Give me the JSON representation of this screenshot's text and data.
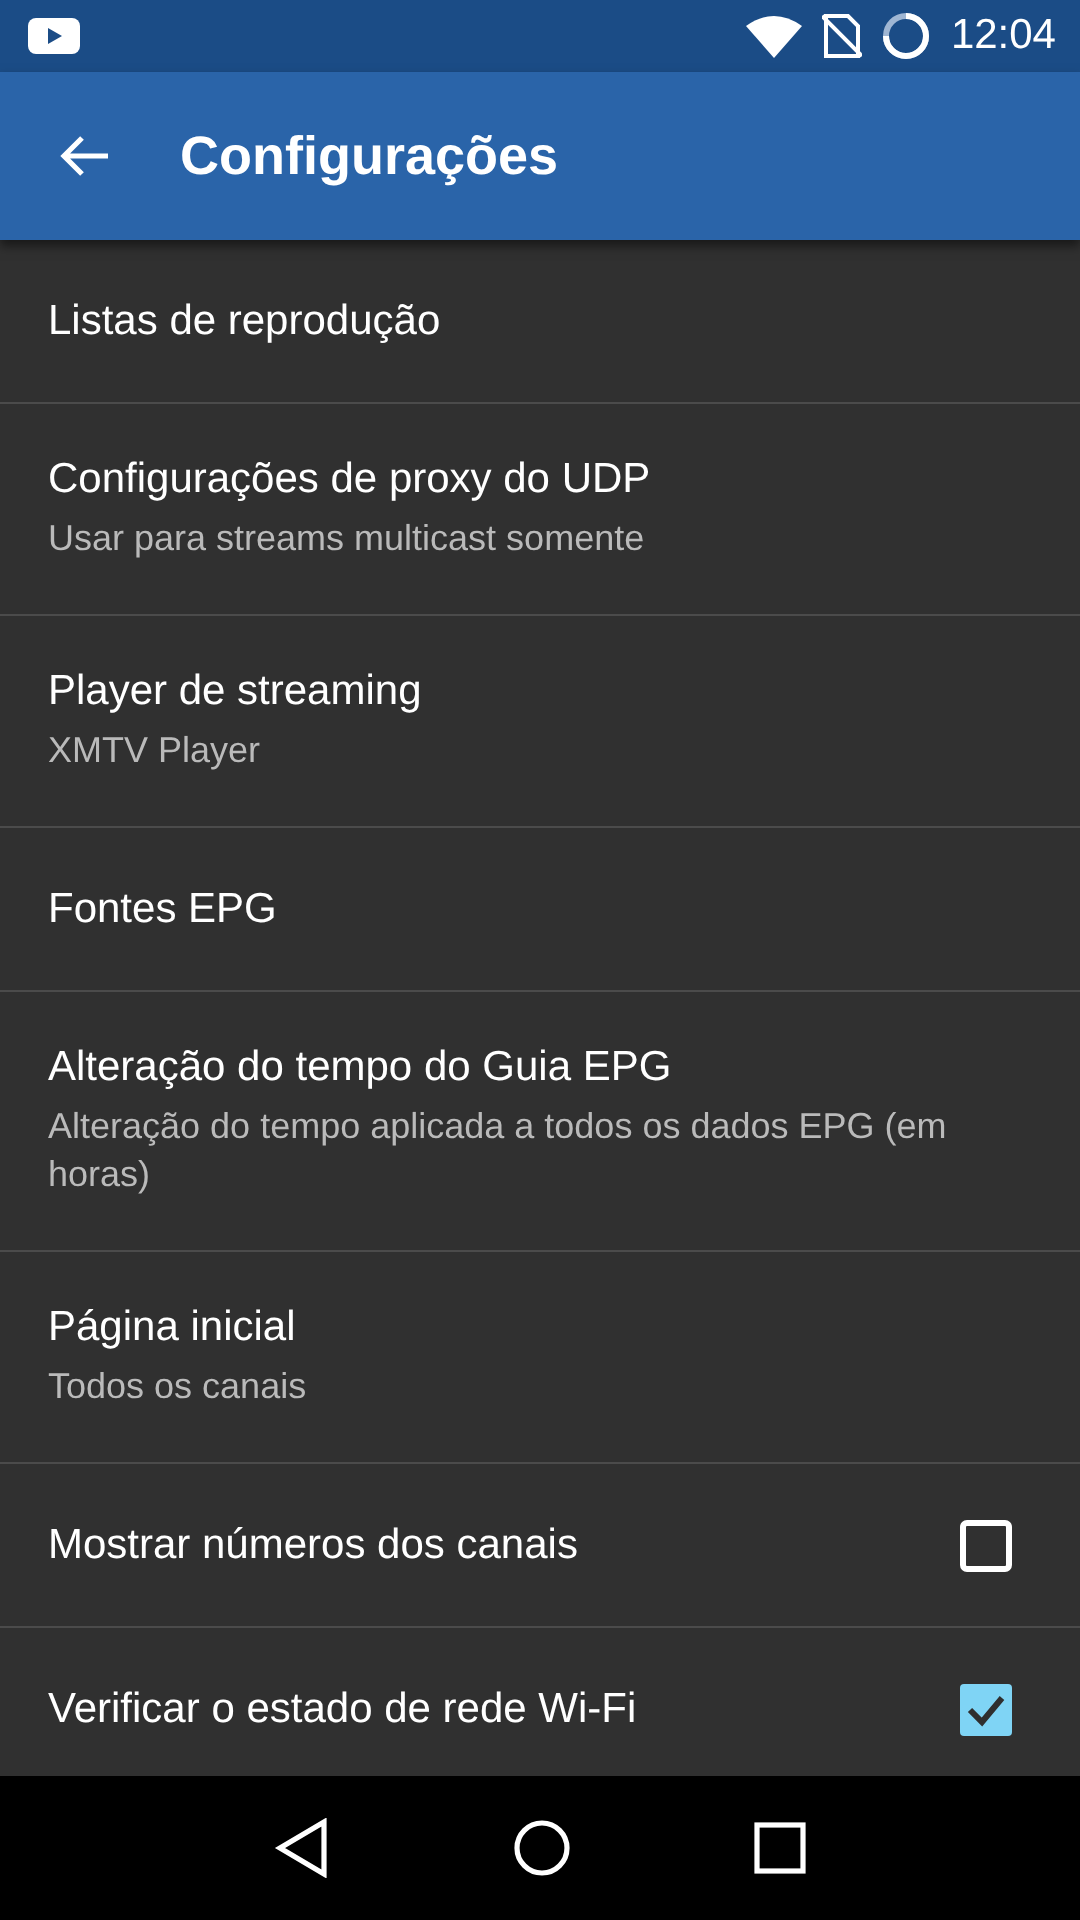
{
  "status_bar": {
    "time": "12:04"
  },
  "toolbar": {
    "title": "Configurações"
  },
  "settings": [
    {
      "kind": "plain",
      "title": "Listas de reprodução"
    },
    {
      "kind": "plain",
      "title": "Configurações de proxy do UDP",
      "subtitle": "Usar para streams multicast somente"
    },
    {
      "kind": "plain",
      "title": "Player de streaming",
      "subtitle": "XMTV Player"
    },
    {
      "kind": "plain",
      "title": "Fontes EPG"
    },
    {
      "kind": "plain",
      "title": "Alteração do tempo do Guia EPG",
      "subtitle": "Alteração do tempo aplicada a todos os dados EPG (em horas)"
    },
    {
      "kind": "plain",
      "title": "Página inicial",
      "subtitle": "Todos os canais"
    },
    {
      "kind": "checkbox",
      "title": "Mostrar números dos canais",
      "checked": false
    },
    {
      "kind": "checkbox",
      "title": "Verificar o estado de rede Wi-Fi",
      "checked": true
    }
  ]
}
